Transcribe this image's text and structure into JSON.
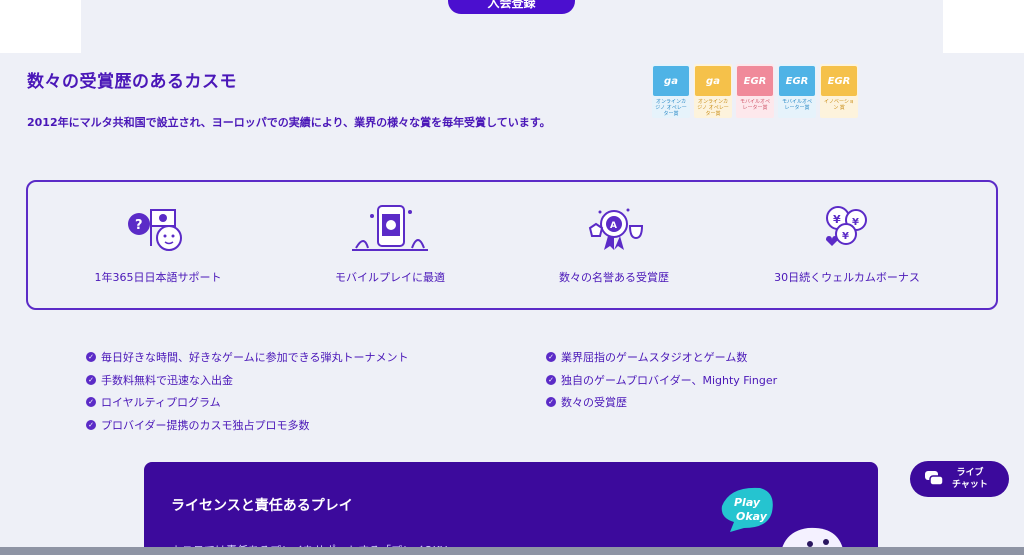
{
  "top": {
    "register_label": "入会登録"
  },
  "awards": {
    "title": "数々の受賞歴のあるカスモ",
    "description": "2012年にマルタ共和国で設立され、ヨーロッパでの実績により、業界の様々な賞を毎年受賞しています。",
    "badges": [
      {
        "year": "2020",
        "logo": "ga",
        "caption": "オンラインカジノ オペレーター賞",
        "color": "#4fb3e6",
        "icon": "ga-award-icon"
      },
      {
        "year": "2020",
        "logo": "ga",
        "caption": "オンラインカジノ オペレーター賞",
        "color": "#f5c14a",
        "icon": "ga-award-icon"
      },
      {
        "year": "2018",
        "logo": "EGR",
        "caption": "モバイルオペ レーター賞",
        "color": "#f08a9a",
        "icon": "egr-award-icon"
      },
      {
        "year": "2017",
        "logo": "EGR",
        "caption": "モバイルオペ レーター賞",
        "color": "#4fb3e6",
        "icon": "egr-award-icon"
      },
      {
        "year": "2018",
        "logo": "EGR",
        "caption": "イノベーション 賞",
        "color": "#f5c14a",
        "icon": "egr-award-icon"
      }
    ]
  },
  "features": [
    {
      "label": "1年365日日本語サポート",
      "icon": "japanese-support-icon"
    },
    {
      "label": "モバイルプレイに最適",
      "icon": "mobile-play-icon"
    },
    {
      "label": "数々の名誉ある受賞歴",
      "icon": "trophy-icon"
    },
    {
      "label": "30日続くウェルカムボーナス",
      "icon": "welcome-bonus-icon"
    }
  ],
  "checklist_left": [
    "毎日好きな時間、好きなゲームに参加できる弾丸トーナメント",
    "手数料無料で迅速な入出金",
    "ロイヤルティプログラム",
    "プロバイダー提携のカスモ独占プロモ多数"
  ],
  "checklist_right": [
    "業界屈指のゲームスタジオとゲーム数",
    "独自のゲームプロバイダー、Mighty Finger",
    "数々の受賞歴"
  ],
  "license": {
    "title": "ライセンスと責任あるプレイ",
    "body": "カスモでは責任あるプレイをサポートする「プレイOKU」ッ",
    "mascot_text_1": "Play",
    "mascot_text_2": "Okay"
  },
  "live_chat": {
    "line1": "ライブ",
    "line2": "チャット"
  },
  "colors": {
    "primary": "#4a17b8",
    "button": "#4b0fcf",
    "panel": "#3c0a9c",
    "background": "#eef0f7"
  }
}
